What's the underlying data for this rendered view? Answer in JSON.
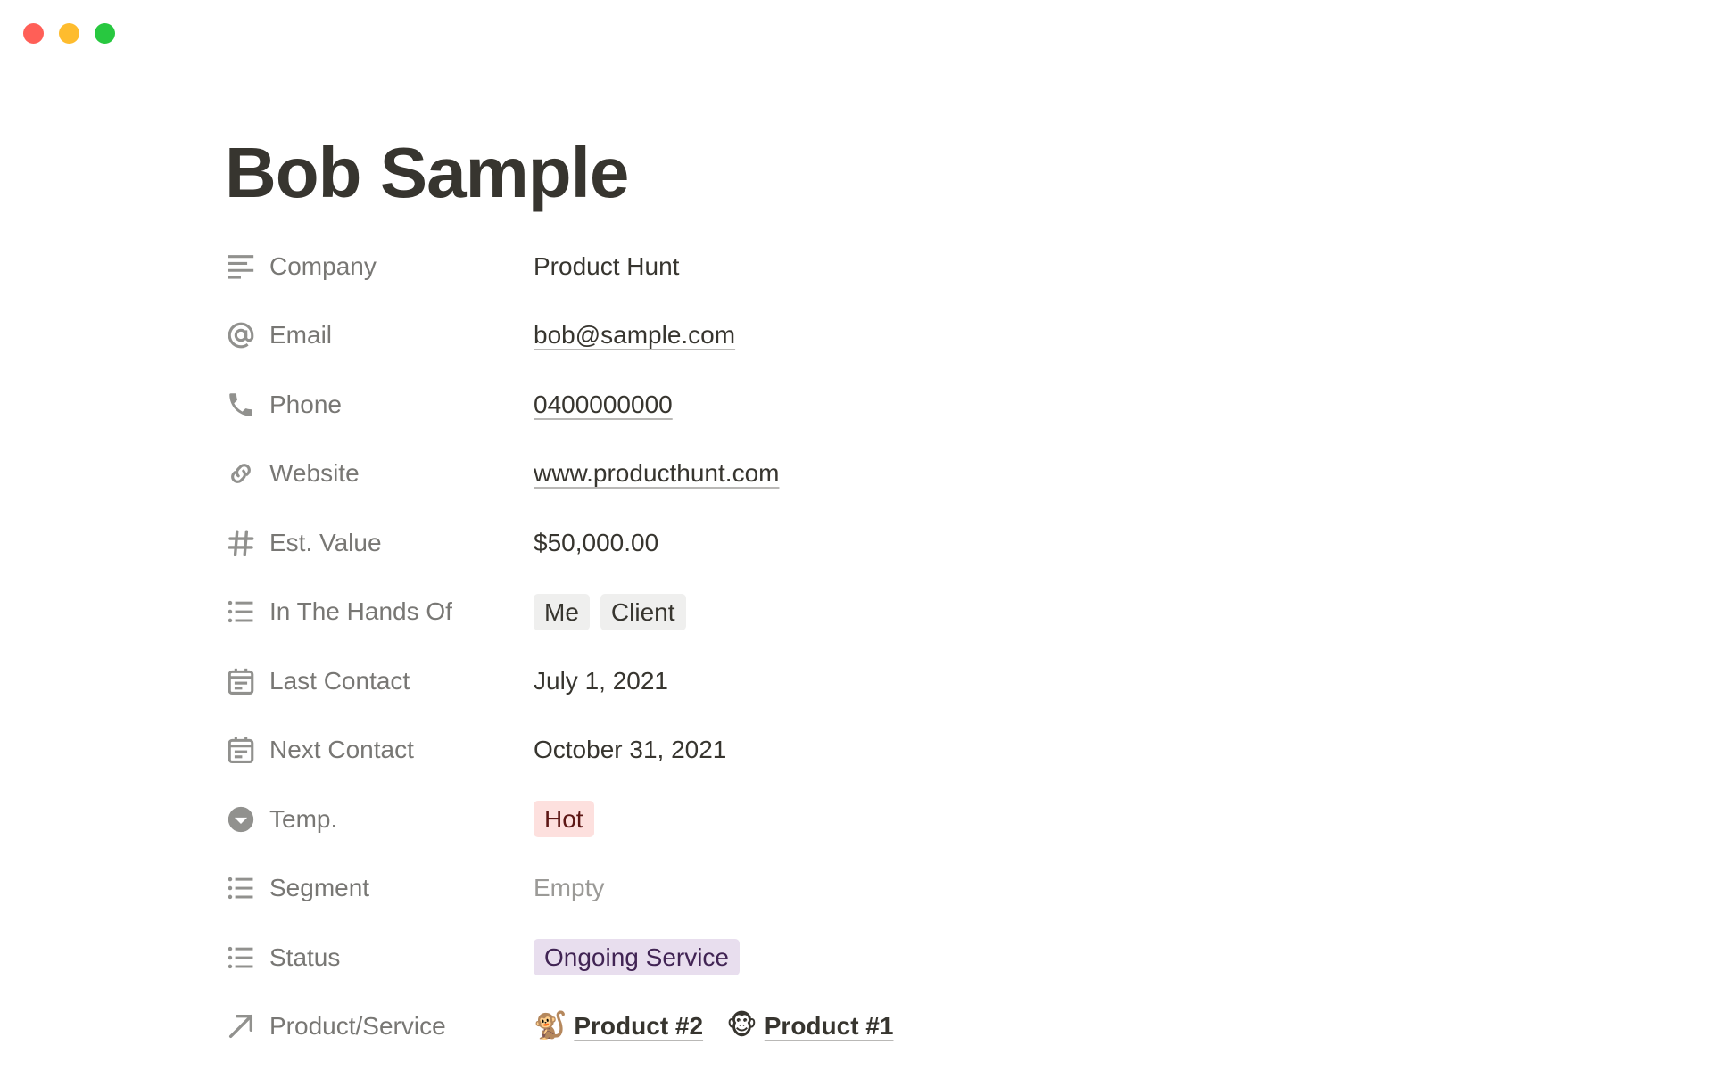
{
  "window": {
    "controls": [
      {
        "name": "close",
        "color": "#ff5f57"
      },
      {
        "name": "minimize",
        "color": "#febc2e"
      },
      {
        "name": "zoom",
        "color": "#28c840"
      }
    ]
  },
  "page": {
    "title": "Bob Sample"
  },
  "properties": {
    "company": {
      "label": "Company",
      "icon": "text-lines-icon",
      "value": "Product Hunt"
    },
    "email": {
      "label": "Email",
      "icon": "at-sign-icon",
      "value": "bob@sample.com"
    },
    "phone": {
      "label": "Phone",
      "icon": "phone-icon",
      "value": "0400000000"
    },
    "website": {
      "label": "Website",
      "icon": "link-icon",
      "value": "www.producthunt.com"
    },
    "est_value": {
      "label": "Est. Value",
      "icon": "hash-icon",
      "value": "$50,000.00"
    },
    "hands_of": {
      "label": "In The Hands Of",
      "icon": "list-icon",
      "tags": [
        "Me",
        "Client"
      ]
    },
    "last_contact": {
      "label": "Last Contact",
      "icon": "calendar-icon",
      "value": "July 1, 2021"
    },
    "next_contact": {
      "label": "Next Contact",
      "icon": "calendar-icon",
      "value": "October 31, 2021"
    },
    "temp": {
      "label": "Temp.",
      "icon": "select-chevron-icon",
      "tag": "Hot",
      "tag_color": "#fde0de"
    },
    "segment": {
      "label": "Segment",
      "icon": "list-icon",
      "value": "Empty"
    },
    "status": {
      "label": "Status",
      "icon": "list-icon",
      "tag": "Ongoing Service",
      "tag_color": "#e8deee"
    },
    "product_service": {
      "label": "Product/Service",
      "icon": "relation-arrow-icon",
      "relations": [
        {
          "emoji": "🐒",
          "label": "Product #2"
        },
        {
          "emoji": "🐵",
          "label": "Product #1"
        }
      ]
    }
  }
}
